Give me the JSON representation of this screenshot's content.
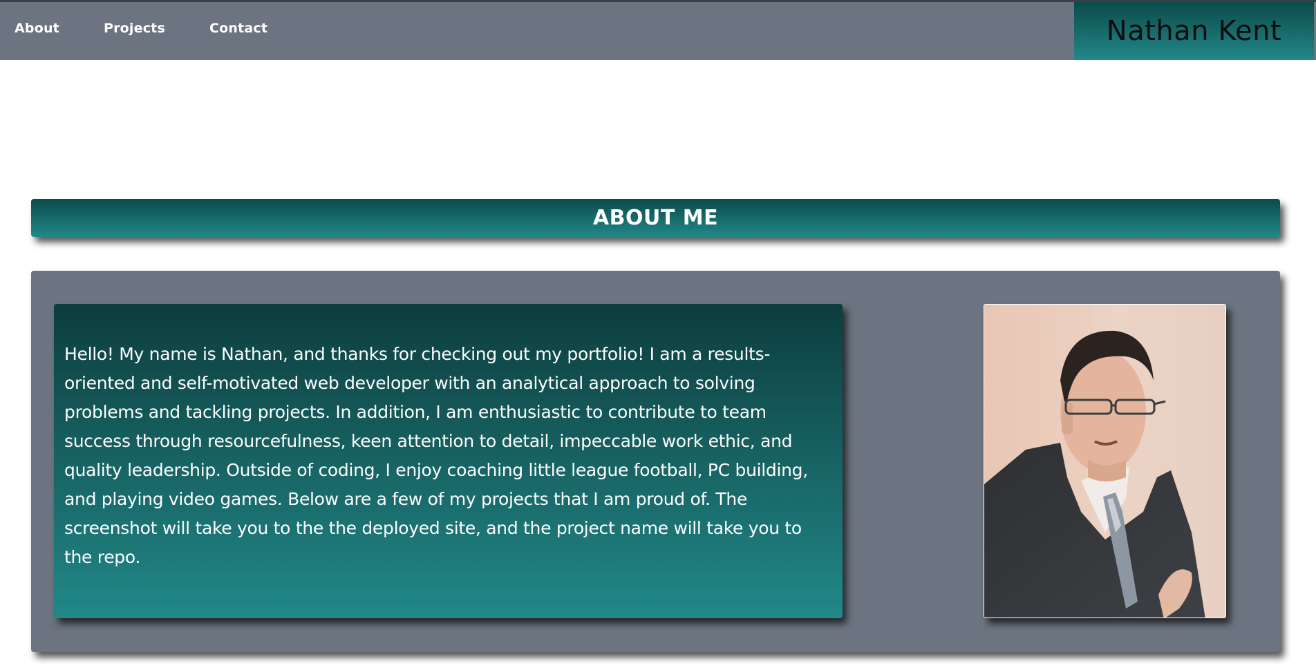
{
  "nav": {
    "items": [
      {
        "label": "About"
      },
      {
        "label": "Projects"
      },
      {
        "label": "Contact"
      }
    ],
    "brand": "Nathan Kent"
  },
  "about": {
    "title": "ABOUT ME",
    "bio": "Hello! My name is Nathan, and thanks for checking out my portfolio! I am a results-oriented and self-motivated web developer with an analytical approach to solving problems and tackling projects. In addition, I am enthusiastic to contribute to team success through resourcefulness, keen attention to detail, impeccable work ethic, and quality leadership. Outside of coding, I enjoy coaching little league football, PC building, and playing video games. Below are a few of my projects that I am proud of. The screenshot will take you to the the deployed site, and the project name will take you to the repo."
  },
  "colors": {
    "nav_background": "#6b7480",
    "accent_dark": "#0d4a4b",
    "accent_light": "#228888",
    "panel": "#6b7480"
  }
}
